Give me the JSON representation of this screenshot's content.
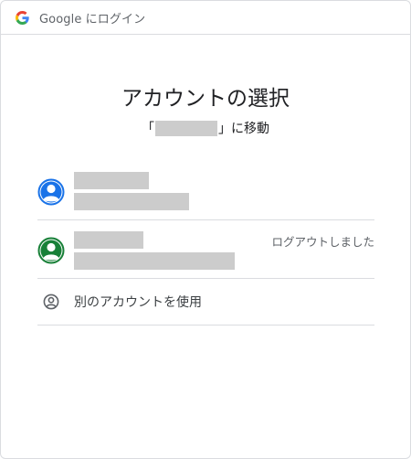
{
  "titlebar": {
    "logo_icon": "google-g-icon",
    "title": "Google にログイン"
  },
  "heading": "アカウントの選択",
  "subheading": {
    "prefix": "「",
    "suffix": "」に移動"
  },
  "accounts": [
    {
      "avatar_color": "#1a73e8",
      "avatar_icon": "person-avatar-icon",
      "status": ""
    },
    {
      "avatar_color": "#188038",
      "avatar_icon": "person-avatar-icon",
      "status": "ログアウトしました"
    }
  ],
  "use_other_account": {
    "icon": "account-circle-icon",
    "label": "別のアカウントを使用"
  },
  "colors": {
    "border": "#dadce0",
    "redaction": "#cccccc",
    "text_primary": "#202124",
    "text_secondary": "#5f6368"
  }
}
